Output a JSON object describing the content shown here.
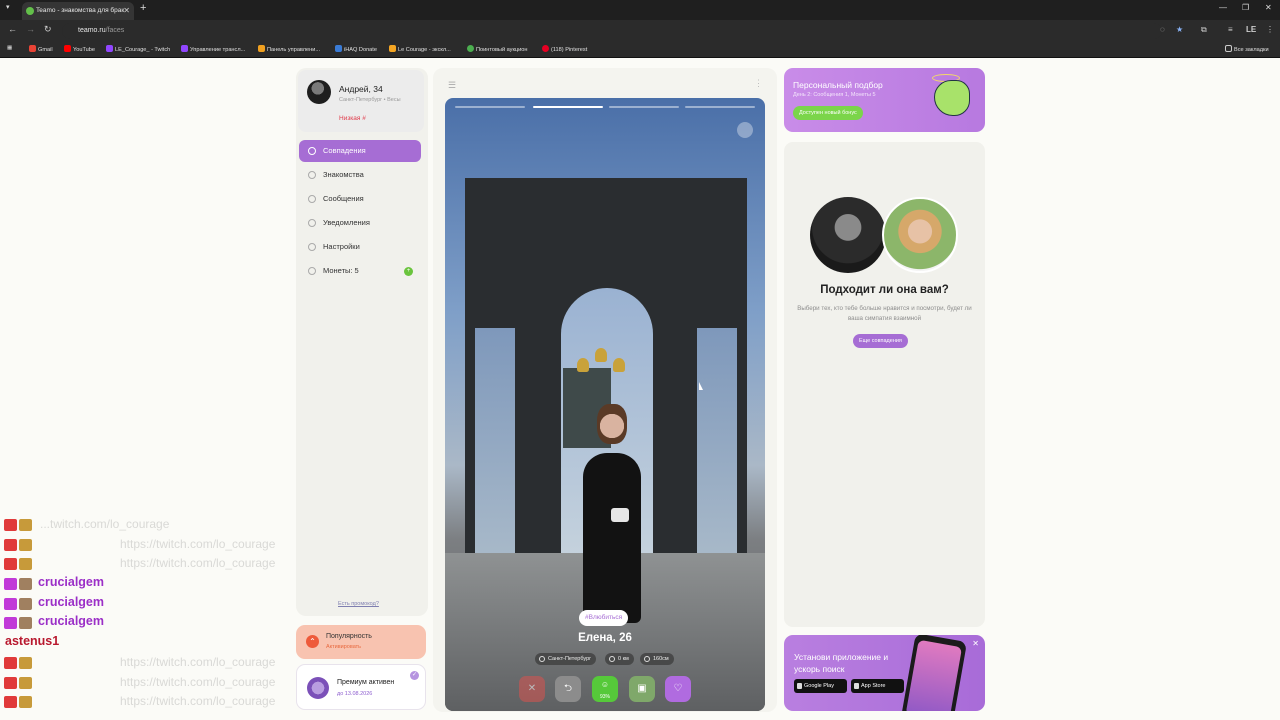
{
  "browser": {
    "tab_title": "Teamo - знакомства для брак",
    "url_host": "teamo.ru",
    "url_path": "/faces",
    "profile_initials": "LE",
    "bookmarks": [
      "Gmail",
      "YouTube",
      "LE_Courage_ - Twitch",
      "Управление трансл...",
      "Панель управлени...",
      "iHAQ Donate",
      "Le Courage - экскл...",
      "Поинтовый аукцион",
      "(118) Pinterest"
    ],
    "all_bookmarks": "Все закладки"
  },
  "profile": {
    "name": "Андрей, 34",
    "city": "Санкт-Петербург",
    "sign": "Весы",
    "level": "Низкая #"
  },
  "menu": [
    {
      "label": "Совпадения",
      "active": true
    },
    {
      "label": "Знакомства"
    },
    {
      "label": "Сообщения"
    },
    {
      "label": "Уведомления"
    },
    {
      "label": "Настройки"
    },
    {
      "label": "Монеты: 5"
    }
  ],
  "promo_link": "Есть промокод?",
  "popularity": {
    "title": "Популярность",
    "action": "Активировать"
  },
  "premium": {
    "title": "Премиум активен",
    "until": "до 13.08.2026"
  },
  "candidate": {
    "tag": "#Влюбиться",
    "name": "Елена, 26",
    "city": "Санкт-Петербург",
    "distance": "0 км",
    "height": "160см",
    "compat": "93%"
  },
  "personal_banner": {
    "title": "Персональный подбор",
    "subtitle": "День 2: Сообщения 1, Монеты 5",
    "button": "Доступен новый бонус"
  },
  "match_panel": {
    "title": "Подходит ли она вам?",
    "subtitle": "Выбери тех, кто тебе больше нравится и посмотри, будет ли ваша симпатия взаимной",
    "button": "Еще совпадения"
  },
  "app_banner": {
    "title": "Установи приложение и ускорь поиск",
    "google": "Google Play",
    "apple": "App Store"
  },
  "chat": [
    {
      "user": "",
      "msg": "...twitch.com/lo_courage",
      "badge": "#e03a3a"
    },
    {
      "user": "",
      "msg": "https://twitch.com/lo_courage",
      "badge": "#e03a3a"
    },
    {
      "user": "",
      "msg": "https://twitch.com/lo_courage",
      "badge": "#e03a3a"
    },
    {
      "user": "crucialgem",
      "msg": "",
      "badge": "#c13ad8"
    },
    {
      "user": "crucialgem",
      "msg": "",
      "badge": "#c13ad8"
    },
    {
      "user": "crucialgem",
      "msg": "",
      "badge": "#c13ad8"
    },
    {
      "user": "astenus1",
      "msg": "",
      "badge": ""
    },
    {
      "user": "",
      "msg": "https://twitch.com/lo_courage",
      "badge": "#e03a3a"
    },
    {
      "user": "",
      "msg": "https://twitch.com/lo_courage",
      "badge": "#e03a3a"
    },
    {
      "user": "",
      "msg": "https://twitch.com/lo_courage",
      "badge": "#e03a3a"
    }
  ],
  "colors": {
    "accent": "#a66dd4",
    "green": "#6ac43d",
    "popular": "#f8c3b0",
    "chat_user": "#9b2fc7",
    "chat_user_alt": "#b8182e"
  }
}
